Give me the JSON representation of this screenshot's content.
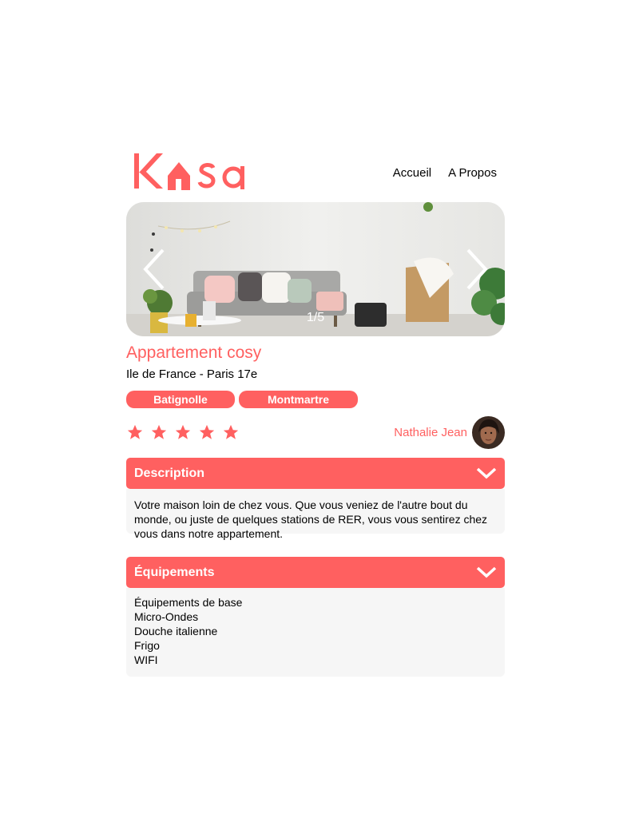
{
  "logo": {
    "text": "Kasa",
    "color": "#ff6060"
  },
  "nav": {
    "home": "Accueil",
    "about": "A Propos"
  },
  "gallery": {
    "counter": "1/5"
  },
  "listing": {
    "title": "Appartement cosy",
    "location": "Ile de France - Paris 17e",
    "tags": [
      "Batignolle",
      "Montmartre"
    ],
    "rating": 5,
    "rating_max": 5
  },
  "host": {
    "name": "Nathalie Jean"
  },
  "description": {
    "title": "Description",
    "text": "Votre maison loin de chez vous. Que vous veniez de l'autre bout du monde, ou juste de quelques stations de RER, vous vous sentirez chez vous dans notre appartement."
  },
  "equipments": {
    "title": "Équipements",
    "items": [
      "Équipements de base",
      "Micro-Ondes",
      "Douche italienne",
      "Frigo",
      "WIFI"
    ]
  },
  "colors": {
    "accent": "#ff6060",
    "panel": "#f6f6f6"
  },
  "icons": {
    "prev": "chevron-left-icon",
    "next": "chevron-right-icon",
    "star": "star-icon",
    "collapse": "chevron-down-icon"
  }
}
